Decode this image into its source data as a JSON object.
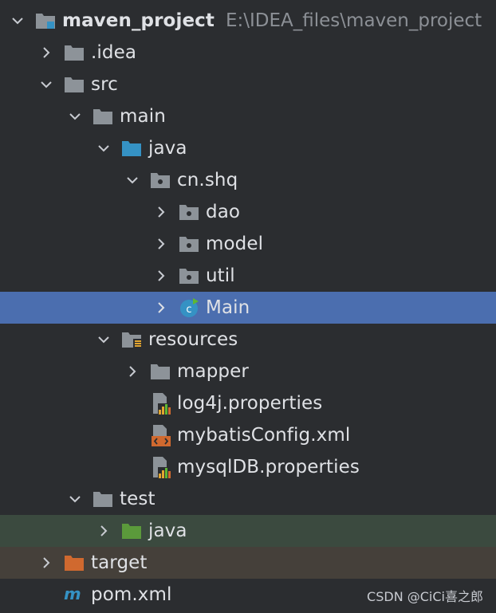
{
  "project": {
    "name": "maven_project",
    "path": "E:\\IDEA_files\\maven_project"
  },
  "tree": [
    {
      "label": ".idea"
    },
    {
      "label": "src"
    },
    {
      "label": "main"
    },
    {
      "label": "java"
    },
    {
      "label": "cn.shq"
    },
    {
      "label": "dao"
    },
    {
      "label": "model"
    },
    {
      "label": "util"
    },
    {
      "label": "Main"
    },
    {
      "label": "resources"
    },
    {
      "label": "mapper"
    },
    {
      "label": "log4j.properties"
    },
    {
      "label": "mybatisConfig.xml"
    },
    {
      "label": "mysqlDB.properties"
    },
    {
      "label": "test"
    },
    {
      "label": "java"
    },
    {
      "label": "target"
    },
    {
      "label": "pom.xml"
    }
  ],
  "watermark": "CSDN @CiCi喜之郎",
  "colors": {
    "background": "#2b2d30",
    "selection": "#4b6eaf",
    "test_row": "#3b4a3f",
    "excluded_row": "#45403a",
    "folder": "#8d9399",
    "source_folder": "#3592c4",
    "test_folder": "#5b9a3b",
    "excluded_folder": "#d0692f"
  }
}
